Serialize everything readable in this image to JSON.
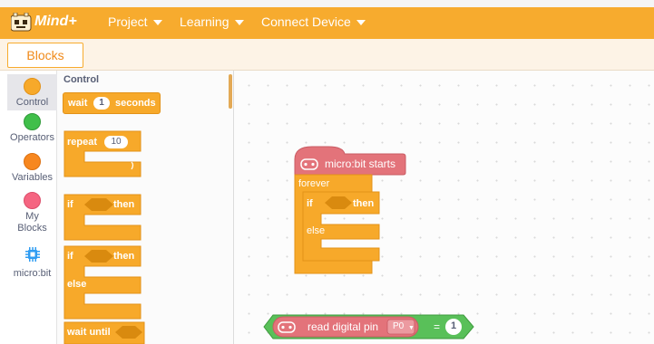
{
  "app": {
    "logo_text": "Mind+"
  },
  "menu": {
    "items": [
      {
        "label": "Project"
      },
      {
        "label": "Learning"
      },
      {
        "label": "Connect Device"
      }
    ]
  },
  "tabs": {
    "active": "Blocks"
  },
  "categories": [
    {
      "label": "Control",
      "color": "#f7a92a",
      "selected": true
    },
    {
      "label": "Operators",
      "color": "#40bf4a"
    },
    {
      "label": "Variables",
      "color": "#f7871f"
    },
    {
      "label_line1": "My",
      "label_line2": "Blocks",
      "color": "#f56581"
    },
    {
      "label": "micro:bit",
      "icon": "chip-icon",
      "color": "#2f9cf2"
    }
  ],
  "palette": {
    "title": "Control",
    "wait": {
      "prefix": "wait",
      "value": "1",
      "suffix": "seconds"
    },
    "repeat": {
      "prefix": "repeat",
      "value": "10"
    },
    "if_then": {
      "if": "if",
      "then": "then"
    },
    "if_else": {
      "if": "if",
      "then": "then",
      "else": "else"
    },
    "wait_until": {
      "label": "wait until"
    }
  },
  "workspace": {
    "hat": {
      "label": "micro:bit starts",
      "color": "#e3737a"
    },
    "forever": {
      "label": "forever"
    },
    "if_else": {
      "if": "if",
      "then": "then",
      "else": "else"
    },
    "reporter": {
      "label": "read digital pin",
      "pin": "P0",
      "operator": "=",
      "value": "1"
    }
  },
  "colors": {
    "accent": "#f7ab2e",
    "control": "#f7a92a",
    "operators": "#5ab75a",
    "microbit": "#e3737a"
  }
}
